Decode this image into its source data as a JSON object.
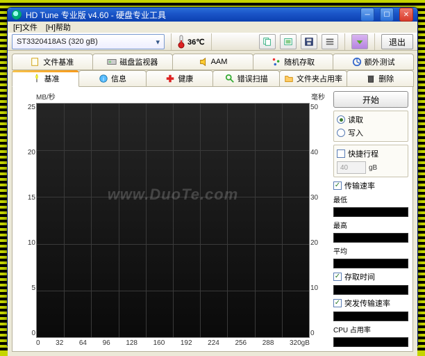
{
  "title": "HD Tune 专业版 v4.60 - 硬盘专业工具",
  "menu": {
    "file": "[F]文件",
    "help": "[H]帮助"
  },
  "drive": {
    "selected": "ST3320418AS (320 gB)"
  },
  "temperature": {
    "value": "36℃"
  },
  "toolbar": {
    "exit": "退出"
  },
  "tabs_top": {
    "benchmark": "文件基准",
    "diskmon": "磁盘监视器",
    "aam": "AAM",
    "random": "随机存取",
    "extra": "额外测试"
  },
  "tabs_bottom": {
    "basic": "基准",
    "info": "信息",
    "health": "健康",
    "errorscan": "错误扫描",
    "folder": "文件夹占用率",
    "delete": "删除"
  },
  "chart_data": {
    "type": "line",
    "title": "",
    "ylabel_left": "MB/秒",
    "ylabel_right": "毫秒",
    "xlabel_unit": "gB",
    "x": [
      0,
      32,
      64,
      96,
      128,
      160,
      192,
      224,
      256,
      288,
      320
    ],
    "y_left_ticks": [
      0,
      5,
      10,
      15,
      20,
      25
    ],
    "y_right_ticks": [
      0,
      10,
      20,
      30,
      40,
      50
    ],
    "x_last_label": "320gB",
    "series": [],
    "watermark": "www.DuoTe.com"
  },
  "side": {
    "start": "开始",
    "mode": {
      "read": "读取",
      "write": "写入",
      "selected": "read"
    },
    "quick": {
      "label": "快捷行程",
      "checked": false,
      "value": "40",
      "unit": "gB"
    },
    "transfer": {
      "label": "传输速率",
      "checked": true,
      "min": "最低",
      "max": "最高",
      "avg": "平均"
    },
    "access": {
      "label": "存取时间",
      "checked": true
    },
    "burst": {
      "label": "突发传输速率",
      "checked": true
    },
    "cpu": {
      "label": "CPU 占用率"
    }
  }
}
